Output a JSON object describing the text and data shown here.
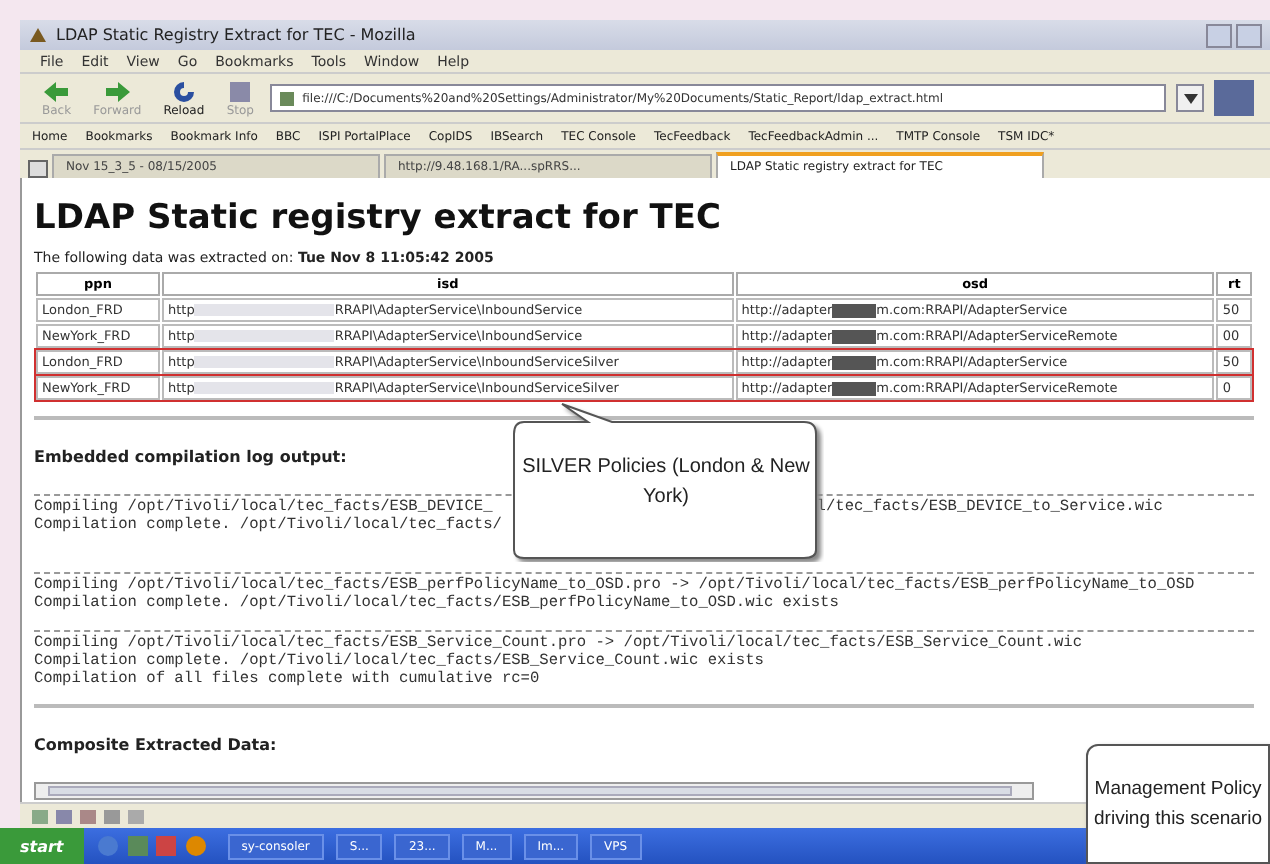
{
  "window": {
    "title": "LDAP Static Registry Extract for TEC - Mozilla"
  },
  "menu": [
    "File",
    "Edit",
    "View",
    "Go",
    "Bookmarks",
    "Tools",
    "Window",
    "Help"
  ],
  "nav_buttons": [
    {
      "label": "Back",
      "disabled": true
    },
    {
      "label": "Forward",
      "disabled": true
    },
    {
      "label": "Reload",
      "disabled": false
    },
    {
      "label": "Stop",
      "disabled": true
    }
  ],
  "address": "file:///C:/Documents%20and%20Settings/Administrator/My%20Documents/Static_Report/ldap_extract.html",
  "bookmarks": [
    "Home",
    "Bookmarks",
    "Bookmark Info",
    "BBC",
    "ISPI PortalPlace",
    "CopIDS",
    "IBSearch",
    "TEC Console",
    "TecFeedback",
    "TecFeedbackAdmin ...",
    "TMTP Console",
    "TSM IDC*"
  ],
  "tabs": [
    {
      "label": "Nov 15_3_5 - 08/15/2005",
      "selected": false
    },
    {
      "label": "http://9.48.168.1/RA...spRRS...",
      "selected": false
    },
    {
      "label": "LDAP Static registry extract for TEC",
      "selected": true
    }
  ],
  "page": {
    "heading": "LDAP Static registry extract for TEC",
    "extract_note": "The following data was extracted on: **Tue Nov 8 11:05:42 2005**",
    "table": {
      "columns": [
        "ppn",
        "isd",
        "osd",
        "rt"
      ],
      "rows": [
        {
          "ppn": "London_FRD",
          "isd_prefix": "http",
          "isd_rest": "RRAPI\\AdapterService\\InboundService",
          "osd_prefix": "http://adapter",
          "osd_rest": "m.com:RRAPI/AdapterService",
          "rt": "50",
          "highlighted": false
        },
        {
          "ppn": "NewYork_FRD",
          "isd_prefix": "http",
          "isd_rest": "RRAPI\\AdapterService\\InboundService",
          "osd_prefix": "http://adapter",
          "osd_rest": "m.com:RRAPI/AdapterServiceRemote",
          "rt": "00",
          "highlighted": false
        },
        {
          "ppn": "London_FRD",
          "isd_prefix": "http",
          "isd_rest": "RRAPI\\AdapterService\\InboundServiceSilver",
          "osd_prefix": "http://adapter",
          "osd_rest": "m.com:RRAPI/AdapterService",
          "rt": "50",
          "highlighted": true
        },
        {
          "ppn": "NewYork_FRD",
          "isd_prefix": "http",
          "isd_rest": "RRAPI\\AdapterService\\InboundServiceSilver",
          "osd_prefix": "http://adapter",
          "osd_rest": "m.com:RRAPI/AdapterServiceRemote",
          "rt": "0",
          "highlighted": true
        }
      ]
    },
    "log_heading": "Embedded compilation log output:",
    "log_blocks": [
      [
        [
          "Compiling /opt/Tivoli/local/tec_facts/ESB_DEVICE_",
          "l/tec_facts/ESB_DEVICE_to_Service.wic"
        ],
        [
          "Compilation complete. /opt/Tivoli/local/tec_facts/"
        ]
      ],
      [
        [
          "Compiling /opt/Tivoli/local/tec_facts/ESB_perfPolicyName_to_OSD.pro -> /opt/Tivoli/local/tec_facts/ESB_perfPolicyName_to_OSD"
        ],
        [
          "Compilation complete. /opt/Tivoli/local/tec_facts/ESB_perfPolicyName_to_OSD.wic exists"
        ]
      ],
      [
        [
          "Compiling /opt/Tivoli/local/tec_facts/ESB_Service_Count.pro -> /opt/Tivoli/local/tec_facts/ESB_Service_Count.wic"
        ],
        [
          "Compilation complete. /opt/Tivoli/local/tec_facts/ESB_Service_Count.wic exists"
        ],
        [
          "Compilation of all files complete with cumulative rc=0"
        ]
      ]
    ],
    "composite_heading": "Composite Extracted Data:"
  },
  "callouts": [
    {
      "text": "SILVER Policies (London & New York)",
      "kind": "pointer"
    },
    {
      "text": "Management Policy driving this scenario",
      "kind": "box"
    }
  ],
  "taskbar": {
    "start": "start",
    "items": [
      "sy-consoler",
      "S...",
      "23...",
      "M...",
      "Im...",
      "VPS"
    ]
  }
}
